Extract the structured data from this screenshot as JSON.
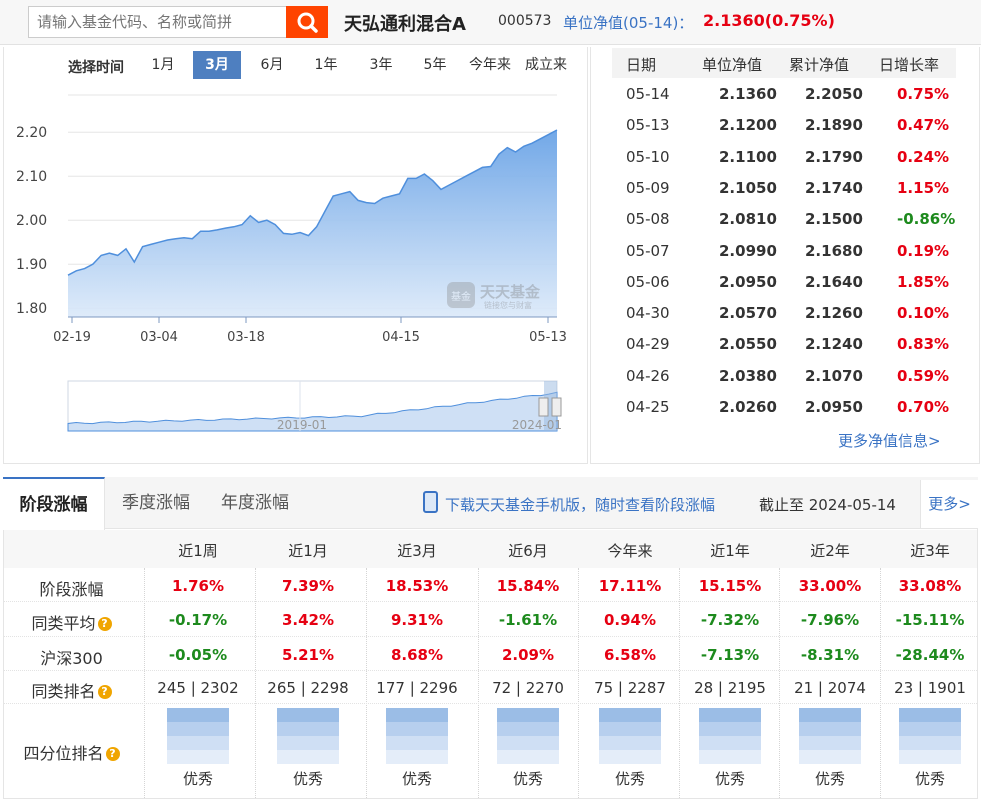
{
  "search": {
    "placeholder": "请输入基金代码、名称或简拼"
  },
  "fund": {
    "name": "天弘通利混合A",
    "code": "000573",
    "nav_label": "单位净值(05-14)：",
    "nav_value": "2.1360",
    "nav_change": "(0.75%)"
  },
  "range": {
    "label": "选择时间",
    "tabs": [
      "1月",
      "3月",
      "6月",
      "1年",
      "3年",
      "5年",
      "今年来",
      "成立来"
    ],
    "active": "3月"
  },
  "watermark": {
    "brand": "天天基金",
    "slogan": "链接您与财富",
    "badge": "基金"
  },
  "chart_data": {
    "type": "area",
    "y_ticks": [
      "2.20",
      "2.10",
      "2.00",
      "1.90",
      "1.80"
    ],
    "ylim": [
      1.78,
      2.28
    ],
    "x_ticks": [
      "02-19",
      "03-04",
      "03-18",
      "04-15",
      "05-13"
    ],
    "values": [
      1.875,
      1.885,
      1.89,
      1.9,
      1.92,
      1.925,
      1.92,
      1.935,
      1.905,
      1.94,
      1.945,
      1.95,
      1.955,
      1.958,
      1.96,
      1.958,
      1.975,
      1.975,
      1.978,
      1.982,
      1.985,
      1.99,
      2.01,
      1.995,
      2.0,
      1.99,
      1.97,
      1.968,
      1.972,
      1.965,
      1.985,
      2.02,
      2.055,
      2.06,
      2.065,
      2.045,
      2.04,
      2.038,
      2.05,
      2.055,
      2.06,
      2.095,
      2.095,
      2.105,
      2.09,
      2.07,
      2.08,
      2.09,
      2.1,
      2.11,
      2.12,
      2.122,
      2.15,
      2.165,
      2.155,
      2.168,
      2.175,
      2.185,
      2.195,
      2.205
    ],
    "overview_ticks": [
      "2019-01",
      "2024-01"
    ]
  },
  "nav_table": {
    "headers": [
      "日期",
      "单位净值",
      "累计净值",
      "日增长率"
    ],
    "rows": [
      {
        "date": "05-14",
        "unit": "2.1360",
        "acc": "2.2050",
        "chg": "0.75%",
        "sign": "pos"
      },
      {
        "date": "05-13",
        "unit": "2.1200",
        "acc": "2.1890",
        "chg": "0.47%",
        "sign": "pos"
      },
      {
        "date": "05-10",
        "unit": "2.1100",
        "acc": "2.1790",
        "chg": "0.24%",
        "sign": "pos"
      },
      {
        "date": "05-09",
        "unit": "2.1050",
        "acc": "2.1740",
        "chg": "1.15%",
        "sign": "pos"
      },
      {
        "date": "05-08",
        "unit": "2.0810",
        "acc": "2.1500",
        "chg": "-0.86%",
        "sign": "neg"
      },
      {
        "date": "05-07",
        "unit": "2.0990",
        "acc": "2.1680",
        "chg": "0.19%",
        "sign": "pos"
      },
      {
        "date": "05-06",
        "unit": "2.0950",
        "acc": "2.1640",
        "chg": "1.85%",
        "sign": "pos"
      },
      {
        "date": "04-30",
        "unit": "2.0570",
        "acc": "2.1260",
        "chg": "0.10%",
        "sign": "pos"
      },
      {
        "date": "04-29",
        "unit": "2.0550",
        "acc": "2.1240",
        "chg": "0.83%",
        "sign": "pos"
      },
      {
        "date": "04-26",
        "unit": "2.0380",
        "acc": "2.1070",
        "chg": "0.59%",
        "sign": "pos"
      },
      {
        "date": "04-25",
        "unit": "2.0260",
        "acc": "2.0950",
        "chg": "0.70%",
        "sign": "pos"
      }
    ],
    "more": "更多净值信息>"
  },
  "perf": {
    "tabs": [
      "阶段涨幅",
      "季度涨幅",
      "年度涨幅"
    ],
    "promo": "下载天天基金手机版，随时查看阶段涨幅",
    "asof": "截止至 2024-05-14",
    "more": "更多>",
    "periods": [
      "近1周",
      "近1月",
      "近3月",
      "近6月",
      "今年来",
      "近1年",
      "近2年",
      "近3年"
    ],
    "rows": [
      {
        "label": "阶段涨幅",
        "help": false,
        "values": [
          "1.76%",
          "7.39%",
          "18.53%",
          "15.84%",
          "17.11%",
          "15.15%",
          "33.00%",
          "33.08%"
        ]
      },
      {
        "label": "同类平均",
        "help": true,
        "values": [
          "-0.17%",
          "3.42%",
          "9.31%",
          "-1.61%",
          "0.94%",
          "-7.32%",
          "-7.96%",
          "-15.11%"
        ]
      },
      {
        "label": "沪深300",
        "help": false,
        "values": [
          "-0.05%",
          "5.21%",
          "8.68%",
          "2.09%",
          "6.58%",
          "-7.13%",
          "-8.31%",
          "-28.44%"
        ]
      },
      {
        "label": "同类排名",
        "help": true,
        "values": [
          "245 | 2302",
          "265 | 2298",
          "177 | 2296",
          "72 | 2270",
          "75 | 2287",
          "28 | 2195",
          "21 | 2074",
          "23 | 1901"
        ]
      }
    ],
    "quartile_label": "四分位排名",
    "quartile_values": [
      "优秀",
      "优秀",
      "优秀",
      "优秀",
      "优秀",
      "优秀",
      "优秀",
      "优秀"
    ],
    "help_glyph": "?",
    "colors": {
      "up": "#e60012",
      "down": "#1d8a1d",
      "accent": "#3a73c4"
    }
  }
}
